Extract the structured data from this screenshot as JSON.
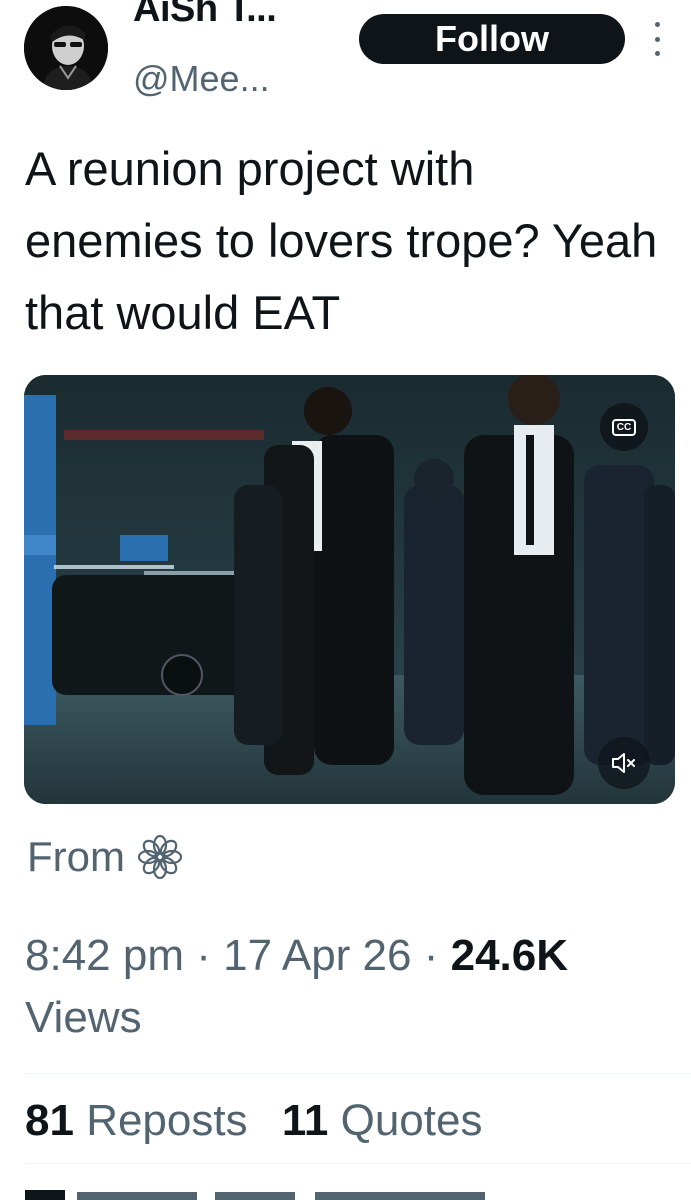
{
  "author": {
    "display_name": "AiSh T...",
    "handle": "@Mee...",
    "avatar_icon": "avatar-photo"
  },
  "actions": {
    "follow_label": "Follow",
    "more_icon": "more-vertical-icon"
  },
  "tweet": {
    "text": "A reunion project with enemies to lovers trope? Yeah that would EAT"
  },
  "media": {
    "type": "video",
    "cc_label": "CC",
    "mute_icon": "speaker-muted-icon"
  },
  "source": {
    "label": "From",
    "icon": "flower-outline-icon"
  },
  "meta": {
    "time": "8:42 pm",
    "separator": "·",
    "date": "17 Apr 26",
    "views_count": "24.6K",
    "views_label": "Views"
  },
  "stats": {
    "reposts_count": "81",
    "reposts_label": "Reposts",
    "quotes_count": "11",
    "quotes_label": "Quotes"
  },
  "colors": {
    "text_primary": "#0f1419",
    "text_secondary": "#536471",
    "divider": "#eff3f4",
    "button_bg": "#0f1419"
  }
}
